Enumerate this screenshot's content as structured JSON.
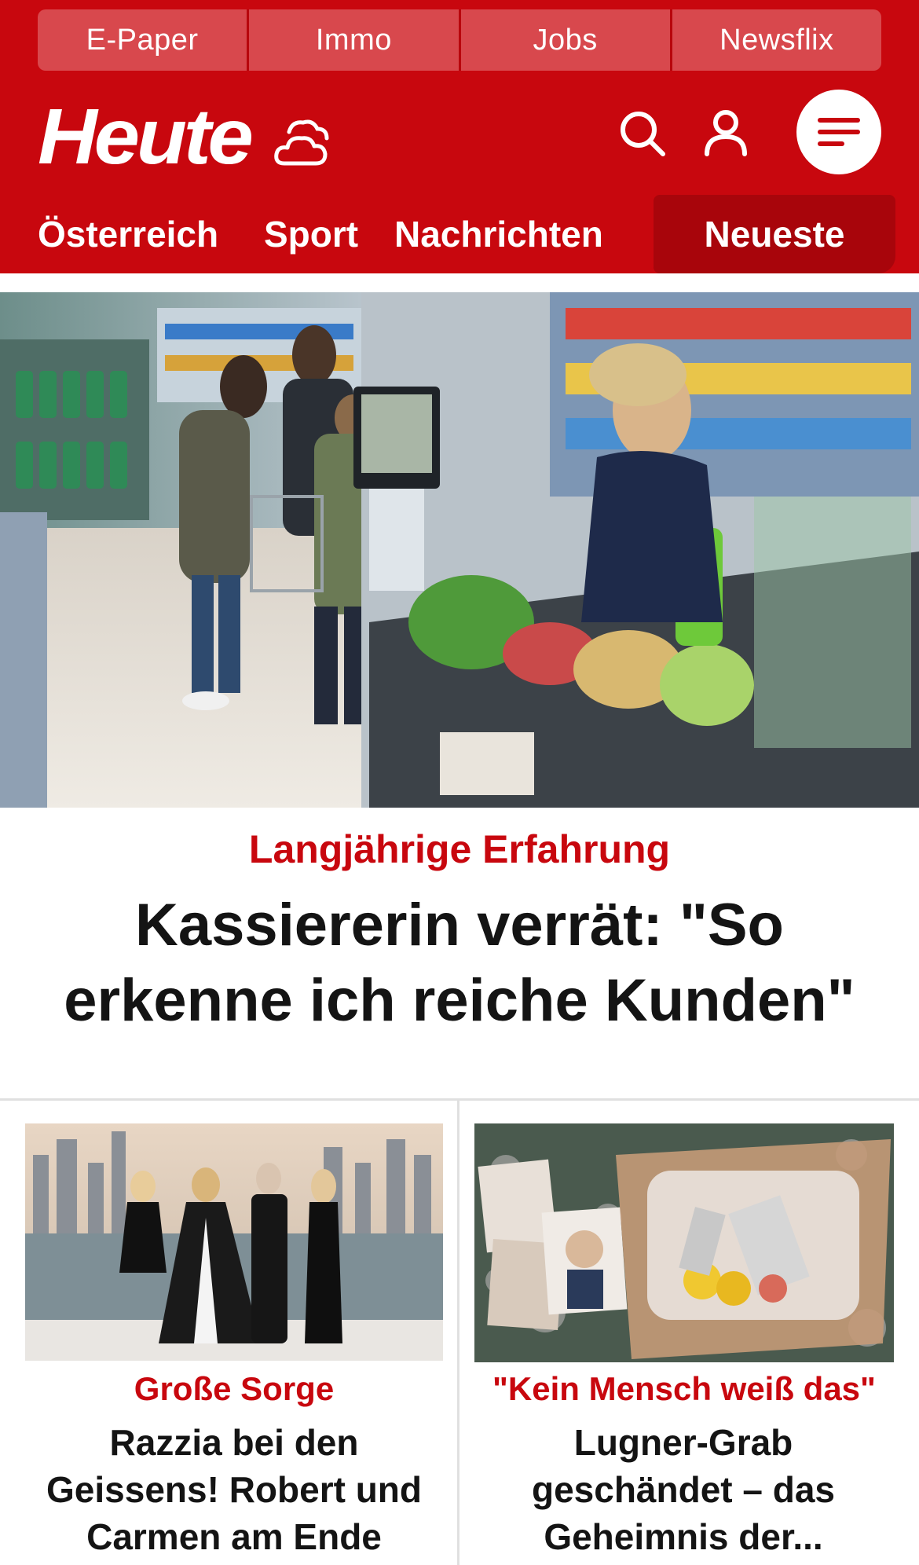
{
  "top_links": [
    "E-Paper",
    "Immo",
    "Jobs",
    "Newsflix"
  ],
  "brand": {
    "logo_text": "Heute",
    "accent": "#c8070e"
  },
  "icons": {
    "weather": "cloud-weather-icon",
    "search": "search-icon",
    "account": "user-icon",
    "menu": "hamburger-menu-icon"
  },
  "nav": {
    "items": [
      "Österreich",
      "Sport",
      "Nachrichten"
    ],
    "active": "Neueste"
  },
  "hero": {
    "kicker": "Langjährige Erfahrung",
    "title": "Kassiererin verrät: \"So erkenne ich reiche Kunden\""
  },
  "cards": [
    {
      "kicker": "Große Sorge",
      "title": "Razzia bei den Geissens! Robert und Carmen am Ende"
    },
    {
      "kicker": "\"Kein Mensch weiß das\"",
      "title": "Lugner-Grab geschändet – das Geheimnis der..."
    }
  ]
}
